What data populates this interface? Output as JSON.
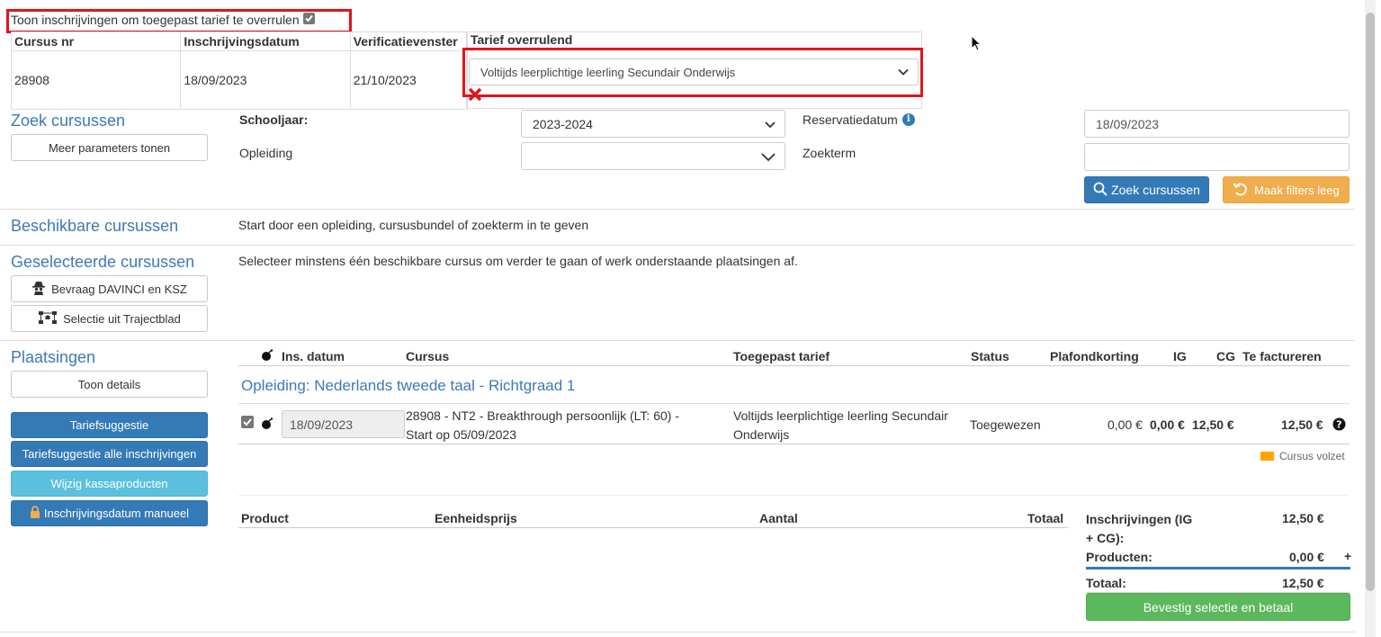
{
  "override": {
    "checkbox_label": "Toon inschrijvingen om toegepast tarief te overrulen",
    "checked": true,
    "columns": [
      "Cursus nr",
      "Inschrijvingsdatum",
      "Verificatievenster",
      "Tarief overrulend"
    ],
    "row": {
      "cursus_nr": "28908",
      "inschrijvingsdatum": "18/09/2023",
      "verificatievenster": "21/10/2023",
      "tarief": "Voltijds leerplichtige leerling Secundair Onderwijs"
    }
  },
  "search": {
    "title": "Zoek cursussen",
    "more_params_label": "Meer parameters tonen",
    "schooljaar_label": "Schooljaar:",
    "schooljaar_value": "2023-2024",
    "opleiding_label": "Opleiding",
    "opleiding_value": "",
    "reservatiedatum_label": "Reservatiedatum",
    "reservatiedatum_value": "18/09/2023",
    "zoekterm_label": "Zoekterm",
    "zoekterm_value": "",
    "search_button": "Zoek cursussen",
    "clear_button": "Maak filters leeg"
  },
  "available": {
    "title": "Beschikbare cursussen",
    "message": "Start door een opleiding, cursusbundel of zoekterm in te geven"
  },
  "selected": {
    "title": "Geselecteerde cursussen",
    "message": "Selecteer minstens één beschikbare cursus om verder te gaan of werk onderstaande plaatsingen af.",
    "davinci_button": "Bevraag DAVINCI en KSZ",
    "traject_button": "Selectie uit Trajectblad"
  },
  "placements": {
    "title": "Plaatsingen",
    "details_button": "Toon details",
    "tariefsuggestie_button": "Tariefsuggestie",
    "tariefsuggestie_alle_button": "Tariefsuggestie alle inschrijvingen",
    "wijzig_button": "Wijzig kassaproducten",
    "manueel_button": "Inschrijvingsdatum manueel",
    "headers": {
      "ins_datum": "Ins. datum",
      "cursus": "Cursus",
      "tarief": "Toegepast tarief",
      "status": "Status",
      "plafond": "Plafondkorting",
      "ig": "IG",
      "cg": "CG",
      "factureren": "Te factureren"
    },
    "opleiding_title": "Opleiding: Nederlands tweede taal - Richtgraad 1",
    "row": {
      "checked": true,
      "ins_datum": "18/09/2023",
      "cursus_line1": "28908 - NT2 - Breakthrough persoonlijk (LT: 60) -",
      "cursus_line2": "Start op 05/09/2023",
      "tarief_line1": "Voltijds leerplichtige leerling Secundair",
      "tarief_line2": "Onderwijs",
      "status": "Toegewezen",
      "plafond": "0,00 €",
      "ig": "0,00 €",
      "cg": "12,50 €",
      "factureren": "12,50 €"
    },
    "legend": "Cursus volzet",
    "legend_color": "#ffa500"
  },
  "products": {
    "headers": {
      "product": "Product",
      "eenheidsprijs": "Eenheidsprijs",
      "aantal": "Aantal",
      "totaal": "Totaal"
    }
  },
  "summary": {
    "inschrijvingen_label_1": "Inschrijvingen (IG",
    "inschrijvingen_label_2": "+ CG):",
    "inschrijvingen_value": "12,50 €",
    "producten_label": "Producten:",
    "producten_value": "0,00 €",
    "plus": "+",
    "totaal_label": "Totaal:",
    "totaal_value": "12,50 €",
    "confirm_button": "Bevestig selectie en betaal"
  },
  "colors": {
    "accent_blue": "#337ab7",
    "title_blue": "#3c7ab7",
    "highlight_red": "#e1141c",
    "success_green": "#5cb85c",
    "warning_orange": "#f0ad4e",
    "info_blue": "#5bc0de"
  }
}
